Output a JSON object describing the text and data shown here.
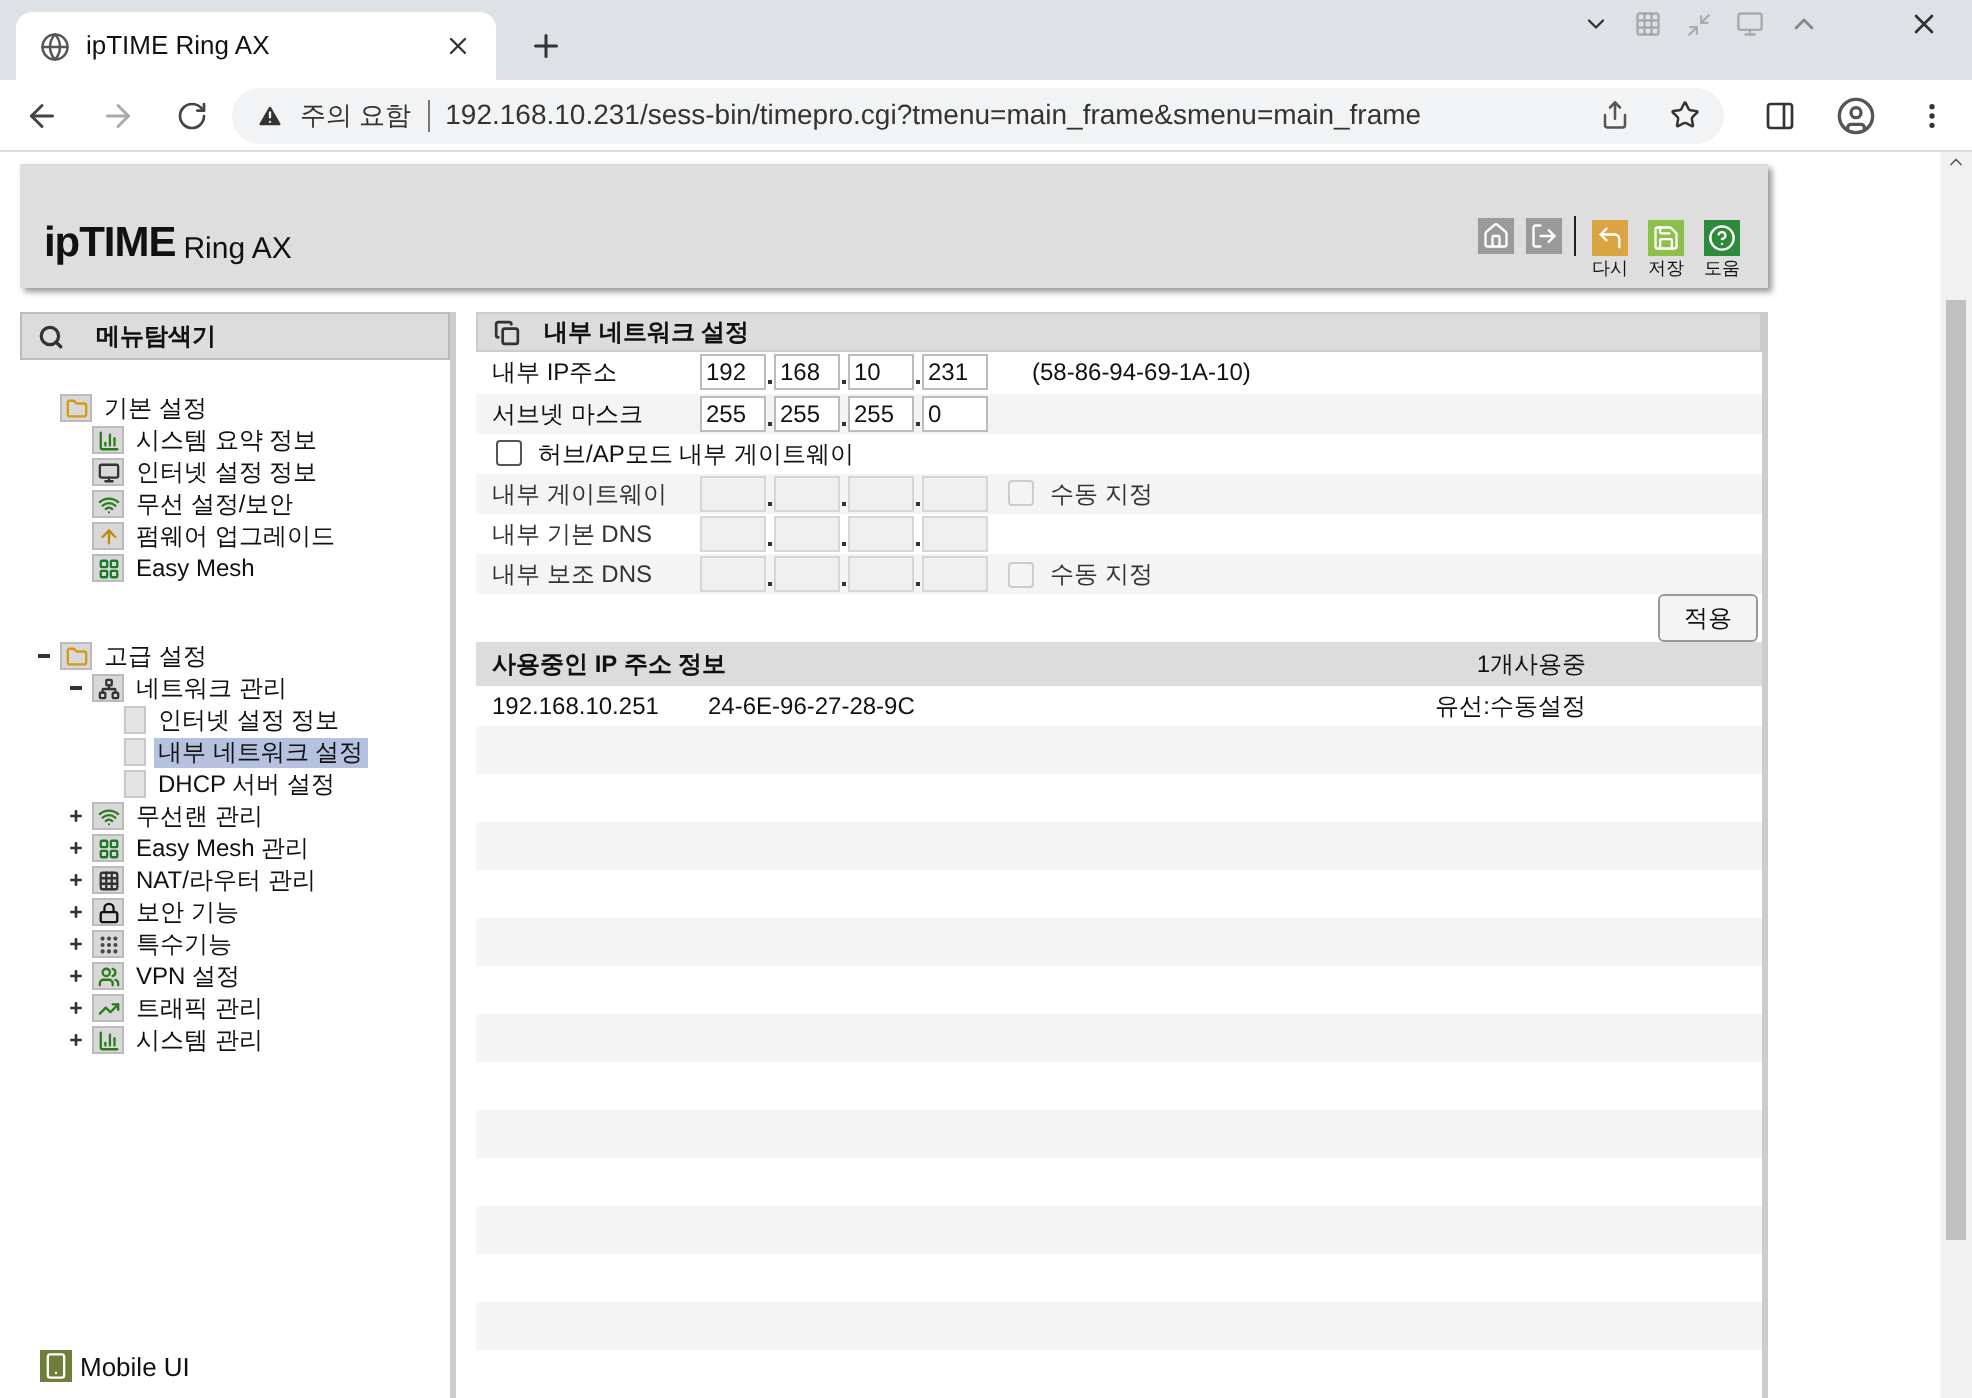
{
  "browser": {
    "tab_title": "ipTIME Ring AX",
    "security_label": "주의 요함",
    "url": "192.168.10.231/sess-bin/timepro.cgi?tmenu=main_frame&smenu=main_frame"
  },
  "header": {
    "brand": "ipTIME",
    "model": "Ring AX",
    "actions": [
      {
        "label": "다시",
        "kind": "reload"
      },
      {
        "label": "저장",
        "kind": "save"
      },
      {
        "label": "도움",
        "kind": "help"
      }
    ]
  },
  "sidebar": {
    "title": "메뉴탐색기",
    "tree": [
      {
        "label": "기본 설정",
        "kind": "folder",
        "children": [
          {
            "label": "시스템 요약 정보",
            "kind": "chart"
          },
          {
            "label": "인터넷 설정 정보",
            "kind": "monitor"
          },
          {
            "label": "무선 설정/보안",
            "kind": "wifi"
          },
          {
            "label": "펌웨어 업그레이드",
            "kind": "upgrade"
          },
          {
            "label": "Easy Mesh",
            "kind": "mesh"
          }
        ]
      },
      {
        "label": "고급 설정",
        "kind": "folder",
        "expanded": true,
        "children": [
          {
            "label": "네트워크 관리",
            "kind": "network",
            "expanded": true,
            "children": [
              {
                "label": "인터넷 설정 정보",
                "kind": "page",
                "selected": false
              },
              {
                "label": "내부 네트워크 설정",
                "kind": "page",
                "selected": true
              },
              {
                "label": "DHCP 서버 설정",
                "kind": "page",
                "selected": false
              }
            ]
          },
          {
            "label": "무선랜 관리",
            "kind": "wifi",
            "expanded": false
          },
          {
            "label": "Easy Mesh 관리",
            "kind": "mesh",
            "expanded": false
          },
          {
            "label": "NAT/라우터 관리",
            "kind": "nat",
            "expanded": false
          },
          {
            "label": "보안 기능",
            "kind": "lock",
            "expanded": false
          },
          {
            "label": "특수기능",
            "kind": "special",
            "expanded": false
          },
          {
            "label": "VPN 설정",
            "kind": "vpn",
            "expanded": false
          },
          {
            "label": "트래픽 관리",
            "kind": "traffic",
            "expanded": false
          },
          {
            "label": "시스템 관리",
            "kind": "chart",
            "expanded": false
          }
        ]
      }
    ],
    "footer_link": "Mobile UI"
  },
  "settings": {
    "title": "내부 네트워크 설정",
    "rows": [
      {
        "kind": "ip",
        "label": "내부 IP주소",
        "octets": [
          "192",
          "168",
          "10",
          "231"
        ],
        "disabled": false,
        "note": "(58-86-94-69-1A-10)"
      },
      {
        "kind": "ip",
        "label": "서브넷 마스크",
        "octets": [
          "255",
          "255",
          "255",
          "0"
        ],
        "disabled": false
      },
      {
        "kind": "checkbox",
        "label": "허브/AP모드 내부 게이트웨이",
        "checked": false
      },
      {
        "kind": "ip",
        "label": "내부 게이트웨이",
        "disabled": true,
        "manual": {
          "label": "수동 지정",
          "checked": false,
          "disabled": true
        }
      },
      {
        "kind": "ip",
        "label": "내부 기본 DNS",
        "disabled": true
      },
      {
        "kind": "ip",
        "label": "내부 보조 DNS",
        "disabled": true,
        "manual": {
          "label": "수동 지정",
          "checked": false,
          "disabled": true
        }
      }
    ],
    "apply_button": "적용"
  },
  "leases": {
    "title": "사용중인 IP 주소 정보",
    "count": "1개사용중",
    "rows": [
      {
        "ip": "192.168.10.251",
        "mac": "24-6E-96-27-28-9C",
        "type": "유선:수동설정"
      }
    ]
  }
}
